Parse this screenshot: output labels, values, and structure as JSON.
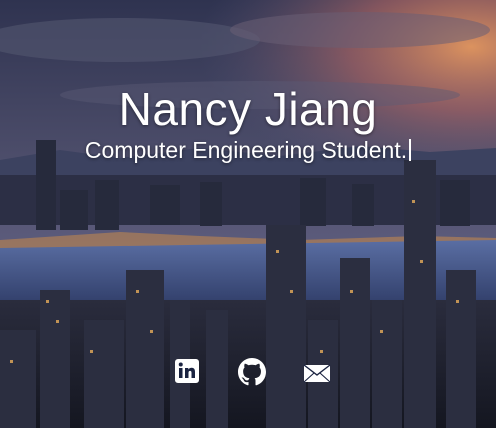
{
  "hero": {
    "name": "Nancy Jiang",
    "tagline": "Computer Engineering Student."
  },
  "social_links": [
    {
      "icon": "linkedin-icon"
    },
    {
      "icon": "github-icon"
    },
    {
      "icon": "email-icon"
    }
  ],
  "colors": {
    "text": "#ffffff",
    "sky_top": "#3a3f5c",
    "sky_glow": "#d9875a",
    "water": "#4a5f93",
    "city_lights": "#f5b65a"
  }
}
